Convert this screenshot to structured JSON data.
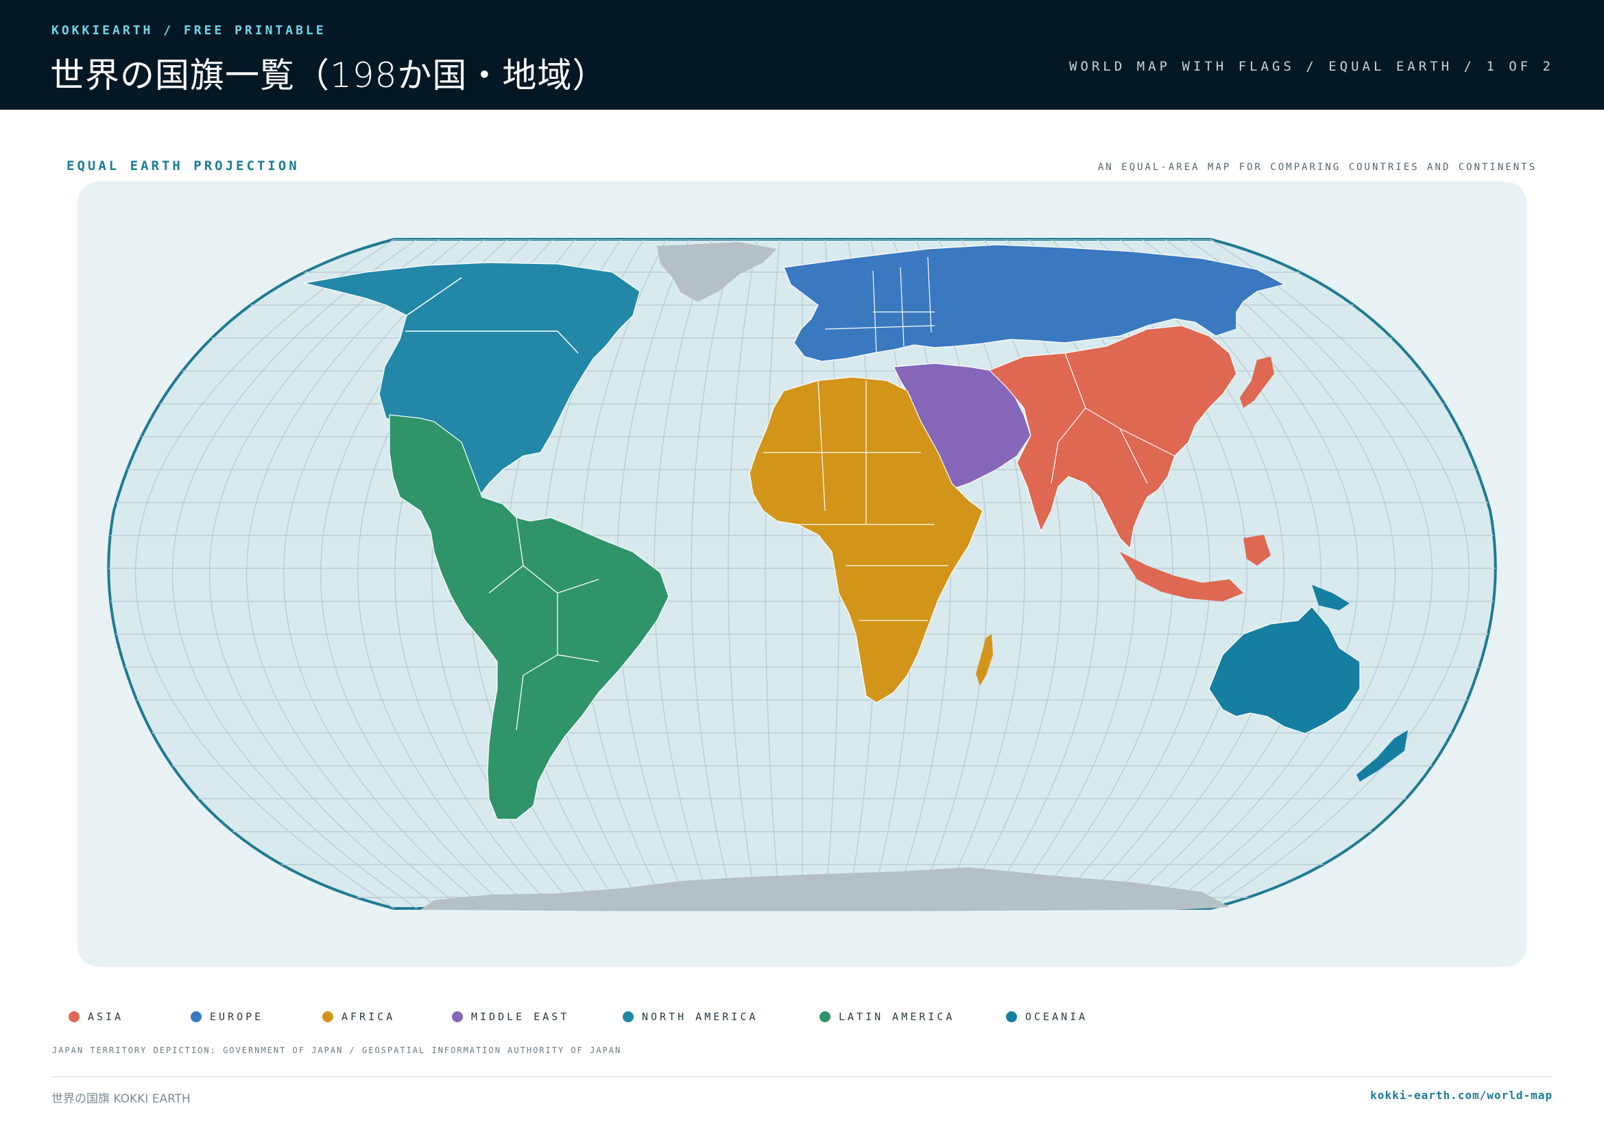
{
  "header": {
    "brand": "KOKKIEARTH / FREE PRINTABLE",
    "title": "世界の国旗一覧（198か国・地域）",
    "subtitle_right": "WORLD MAP WITH FLAGS / EQUAL EARTH / 1 OF 2"
  },
  "map_section": {
    "label": "EQUAL EARTH PROJECTION",
    "note": "AN EQUAL-AREA MAP FOR COMPARING COUNTRIES AND CONTINENTS",
    "projection": "Equal Earth",
    "graticule": true
  },
  "legend": [
    {
      "label": "ASIA",
      "color": "#de6852"
    },
    {
      "label": "EUROPE",
      "color": "#3a78bf"
    },
    {
      "label": "AFRICA",
      "color": "#d39519"
    },
    {
      "label": "MIDDLE EAST",
      "color": "#8566b8"
    },
    {
      "label": "NORTH AMERICA",
      "color": "#2388a8"
    },
    {
      "label": "LATIN AMERICA",
      "color": "#30946b"
    },
    {
      "label": "OCEANIA",
      "color": "#167ea0"
    }
  ],
  "colors": {
    "ocean": "#d8eaee",
    "frame": "#1f7a92",
    "graticule": "#b9ccd3",
    "unassigned_land": "#b5c0c6",
    "header_bg": "#031824",
    "accent": "#1a7d93"
  },
  "credit": "JAPAN TERRITORY DEPICTION: GOVERNMENT OF JAPAN / GEOSPATIAL INFORMATION AUTHORITY OF JAPAN",
  "footer": {
    "left": "世界の国旗 KOKKI EARTH",
    "right": "kokki-earth.com/world-map"
  }
}
